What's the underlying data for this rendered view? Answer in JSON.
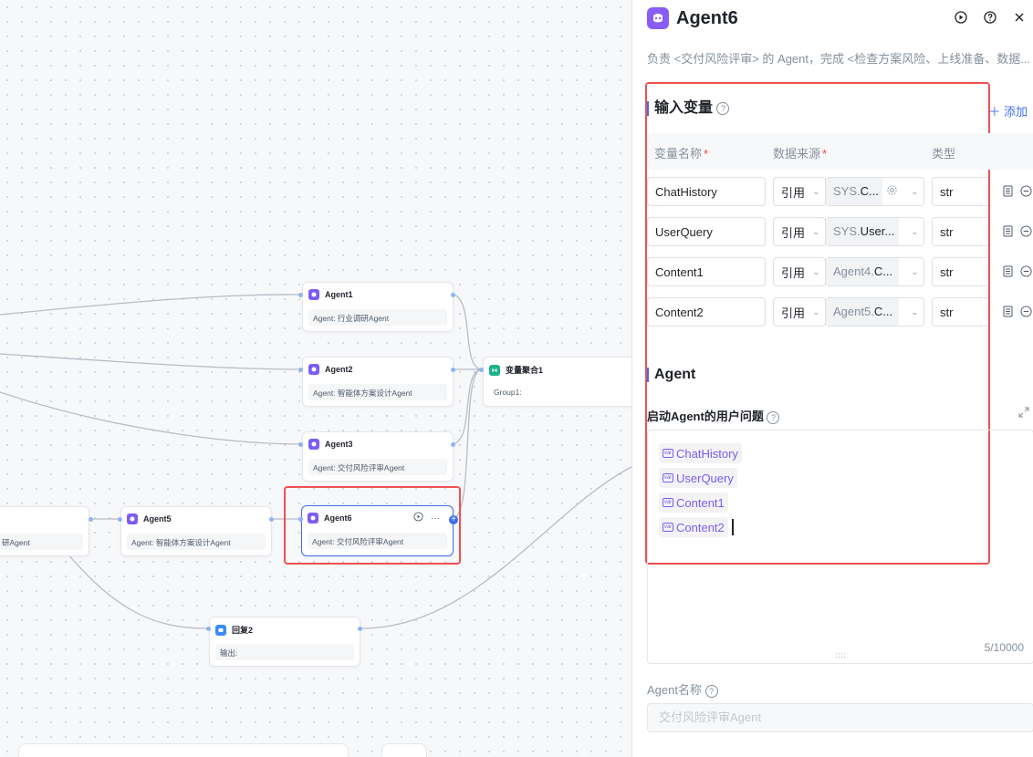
{
  "canvas": {
    "nodes": [
      {
        "id": "agent1",
        "title": "Agent1",
        "sub": "Agent: 行业调研Agent"
      },
      {
        "id": "agent2",
        "title": "Agent2",
        "sub": "Agent: 智能体方案设计Agent"
      },
      {
        "id": "agent3",
        "title": "Agent3",
        "sub": "Agent: 交付风险评审Agent"
      },
      {
        "id": "agent5",
        "title": "Agent5",
        "sub": "Agent: 智能体方案设计Agent"
      },
      {
        "id": "agent6",
        "title": "Agent6",
        "sub": "Agent: 交付风险评审Agent"
      },
      {
        "id": "agg",
        "title": "变量聚合1",
        "sub": "Group1:"
      },
      {
        "id": "reply",
        "title": "回复2",
        "sub": "输出:"
      },
      {
        "id": "partial",
        "title": "",
        "sub": "研Agent"
      }
    ],
    "agent6_more": "···"
  },
  "panel": {
    "title": "Agent6",
    "description": "负责 <交付风险评审> 的 Agent，完成 <检查方案风险、上线准备、数据...",
    "inputs": {
      "title": "输入变量",
      "add_label": "添加",
      "col_name": "变量名称",
      "col_source": "数据来源",
      "col_type": "类型",
      "rows": [
        {
          "name": "ChatHistory",
          "mode": "引用",
          "src_prefix": "SYS.",
          "src_rest": "C...",
          "type": "str"
        },
        {
          "name": "UserQuery",
          "mode": "引用",
          "src_prefix": "SYS.",
          "src_rest": "User...",
          "type": "str"
        },
        {
          "name": "Content1",
          "mode": "引用",
          "src_prefix": "Agent4.",
          "src_rest": "C...",
          "type": "str"
        },
        {
          "name": "Content2",
          "mode": "引用",
          "src_prefix": "Agent5.",
          "src_rest": "C...",
          "type": "str"
        }
      ]
    },
    "agent": {
      "title": "Agent",
      "question_label": "启动Agent的用户问题",
      "tags": [
        "ChatHistory",
        "UserQuery",
        "Content1",
        "Content2"
      ],
      "var_badge": "var",
      "counter": "5/10000",
      "name_label": "Agent名称",
      "name_placeholder": "交付风险评审Agent"
    }
  }
}
